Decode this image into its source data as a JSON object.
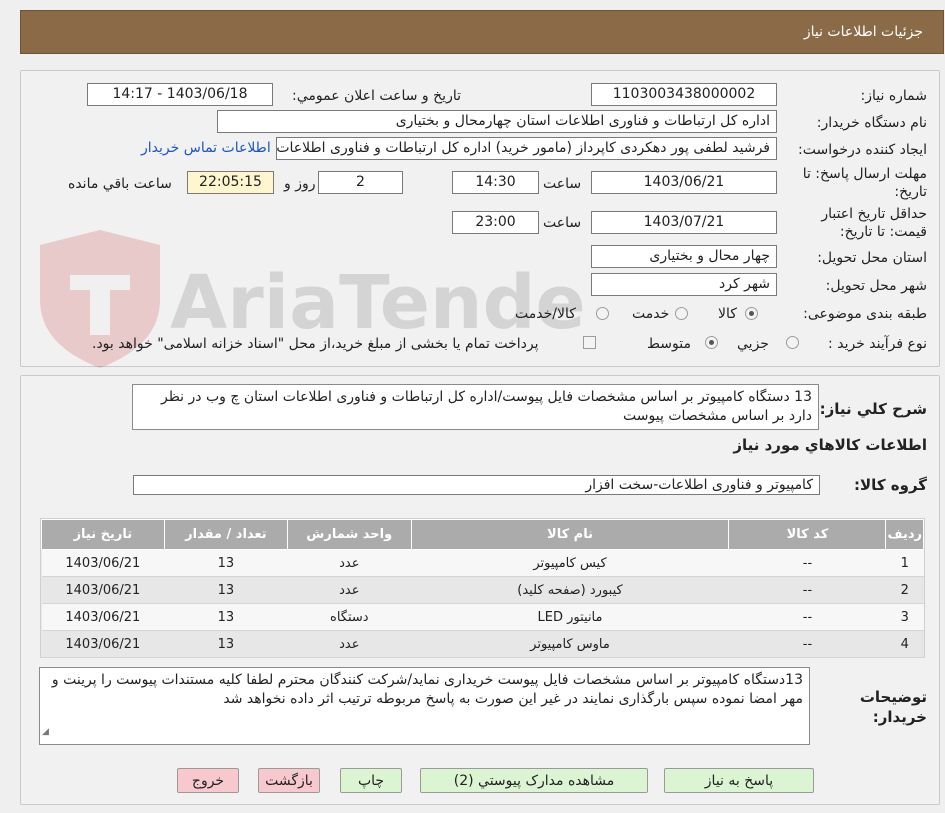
{
  "header": {
    "title": "جزئیات اطلاعات نیاز"
  },
  "details": {
    "need_number_label": "شماره نیاز:",
    "need_number": "1103003438000002",
    "announce_label": "تاریخ و ساعت اعلان عمومي:",
    "announce_value": "1403/06/18 - 14:17",
    "buyer_org_label": "نام دستگاه خریدار:",
    "buyer_org": "اداره کل ارتباطات و فناوری اطلاعات استان چهارمحال و بختیاری",
    "requester_label": "ایجاد کننده درخواست:",
    "requester": "فرشید لطفی پور دهکردی کاپرداز (مامور خرید) اداره کل ارتباطات و فناوری اطلاعات",
    "contact_link": "اطلاعات تماس خریدار",
    "deadline_label_1": "مهلت ارسال پاسخ: تا",
    "deadline_label_2": "تاریخ:",
    "deadline_date": "1403/06/21",
    "time_label": "ساعت",
    "deadline_time": "14:30",
    "days_value": "2",
    "days_label": "روز و",
    "remaining_time": "22:05:15",
    "remaining_label": "ساعت باقي مانده",
    "validity_label_1": "حداقل تاریخ اعتبار",
    "validity_label_2": "قیمت: تا تاریخ:",
    "validity_date": "1403/07/21",
    "validity_time": "23:00",
    "province_label": "استان محل تحویل:",
    "province": "چهار محال و بختیاری",
    "city_label": "شهر محل تحویل:",
    "city": "شهر کرد",
    "category_label": "طبقه بندی موضوعی:",
    "category_options": [
      "کالا",
      "خدمت",
      "کالا/خدمت"
    ],
    "process_label": "نوع فرآیند خرید :",
    "process_options": [
      "جزيي",
      "متوسط"
    ],
    "payment_note": "پرداخت تمام یا بخشی از مبلغ خرید،از محل \"اسناد خزانه اسلامی\" خواهد بود."
  },
  "watermark": {
    "text": "AriaTender.neT"
  },
  "summary": {
    "label": "شرح کلي نياز:",
    "text": "13 دستگاه کامپیوتر بر اساس مشخصات فایل پیوست/اداره کل ارتباطات و فناوری اطلاعات استان چ وب در نظر دارد بر اساس مشخصات پیوست",
    "goods_info_title": "اطلاعات کالاهاي مورد نياز",
    "goods_group_label": "گروه کالا:",
    "goods_group": "کامپیوتر و فناوری اطلاعات-سخت افزار"
  },
  "table": {
    "columns": [
      "ردیف",
      "کد کالا",
      "نام کالا",
      "واحد شمارش",
      "تعداد / مقدار",
      "تاریخ نیاز"
    ],
    "rows": [
      {
        "idx": "1",
        "code": "--",
        "name": "کیس کامپیوتر",
        "unit": "عدد",
        "qty": "13",
        "date": "1403/06/21"
      },
      {
        "idx": "2",
        "code": "--",
        "name": "کیبورد (صفحه کلید)",
        "unit": "عدد",
        "qty": "13",
        "date": "1403/06/21"
      },
      {
        "idx": "3",
        "code": "--",
        "name": "مانیتور LED",
        "unit": "دستگاه",
        "qty": "13",
        "date": "1403/06/21"
      },
      {
        "idx": "4",
        "code": "--",
        "name": "ماوس کامپیوتر",
        "unit": "عدد",
        "qty": "13",
        "date": "1403/06/21"
      }
    ],
    "buyer_notes_label_1": "توضیحات",
    "buyer_notes_label_2": "خریدار:",
    "buyer_notes": "13دستگاه کامپیوتر بر اساس مشخصات فایل پیوست خریداری نماید/شرکت کنندگان محترم لطفا کلیه مستندات پیوست را پرینت و مهر امضا نموده سپس بارگذاری نمایند در غیر این صورت به پاسخ مربوطه ترتیب اثر داده نخواهد شد"
  },
  "buttons": {
    "reply": "پاسخ به نیاز",
    "view_docs": "مشاهده مدارک پیوستي (2)",
    "print": "چاپ",
    "back": "بازگشت",
    "exit": "خروج"
  }
}
